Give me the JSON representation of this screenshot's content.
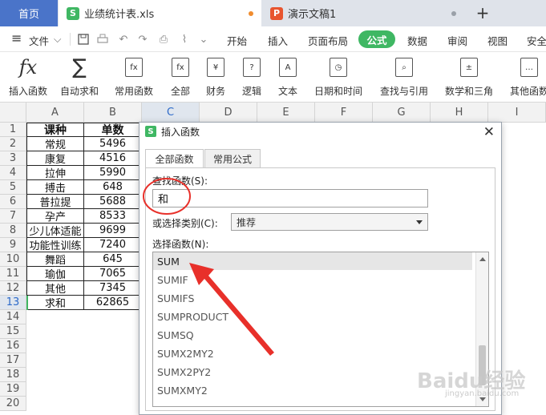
{
  "tabs": {
    "home": "首页",
    "doc1": {
      "badge": "S",
      "label": "业绩统计表.xls",
      "badge_color": "#3fb763",
      "dot_color": "#f08c2e"
    },
    "doc2": {
      "badge": "P",
      "label": "演示文稿1",
      "badge_color": "#e8552f",
      "dot_color": "#9aa0a8"
    },
    "add": "+"
  },
  "menu": {
    "hamburger": "≡",
    "file": "文件",
    "items": [
      "开始",
      "插入",
      "页面布局",
      "公式",
      "数据",
      "审阅",
      "视图",
      "安全"
    ],
    "active": "公式"
  },
  "ribbon": {
    "fx_glyph": "fx",
    "sigma_glyph": "∑",
    "buttons": [
      "插入函数",
      "自动求和",
      "常用函数",
      "全部",
      "财务",
      "逻辑",
      "文本",
      "日期和时间",
      "查找与引用",
      "数学和三角",
      "其他函数"
    ],
    "icon_glyphs": [
      "fx",
      "fx",
      "¥",
      "?",
      "A",
      "◷",
      "⌕",
      "±",
      "…"
    ]
  },
  "sheet": {
    "columns": [
      "A",
      "B",
      "C",
      "D",
      "E",
      "F",
      "G",
      "H",
      "I"
    ],
    "selected_column": "C",
    "rows": [
      "1",
      "2",
      "3",
      "4",
      "5",
      "6",
      "7",
      "8",
      "9",
      "10",
      "11",
      "12",
      "13",
      "14",
      "15",
      "16",
      "17",
      "18",
      "19",
      "20"
    ],
    "selected_row": "13",
    "data": [
      [
        "课种",
        "单数"
      ],
      [
        "常规",
        "5496"
      ],
      [
        "康复",
        "4516"
      ],
      [
        "拉伸",
        "5990"
      ],
      [
        "搏击",
        "648"
      ],
      [
        "普拉提",
        "5688"
      ],
      [
        "孕产",
        "8533"
      ],
      [
        "少儿体适能",
        "9699"
      ],
      [
        "功能性训练",
        "7240"
      ],
      [
        "舞蹈",
        "645"
      ],
      [
        "瑜伽",
        "7065"
      ],
      [
        "其他",
        "7345"
      ],
      [
        "求和",
        "62865"
      ]
    ]
  },
  "dialog": {
    "logo": "S",
    "title": "插入函数",
    "close": "✕",
    "tab_all": "全部函数",
    "tab_common": "常用公式",
    "search_label": "查找函数(S):",
    "search_value": "和",
    "category_label": "或选择类别(C):",
    "category_value": "推荐",
    "list_label": "选择函数(N):",
    "functions": [
      "SUM",
      "SUMIF",
      "SUMIFS",
      "SUMPRODUCT",
      "SUMSQ",
      "SUMX2MY2",
      "SUMX2PY2",
      "SUMXMY2"
    ],
    "selected_function": "SUM"
  },
  "watermark": {
    "text": "Baidu经验",
    "url": "jingyan.baidu.com"
  },
  "colors": {
    "accent": "#3fb763",
    "home_tab": "#4a74c9",
    "annotation": "#e8302a"
  }
}
